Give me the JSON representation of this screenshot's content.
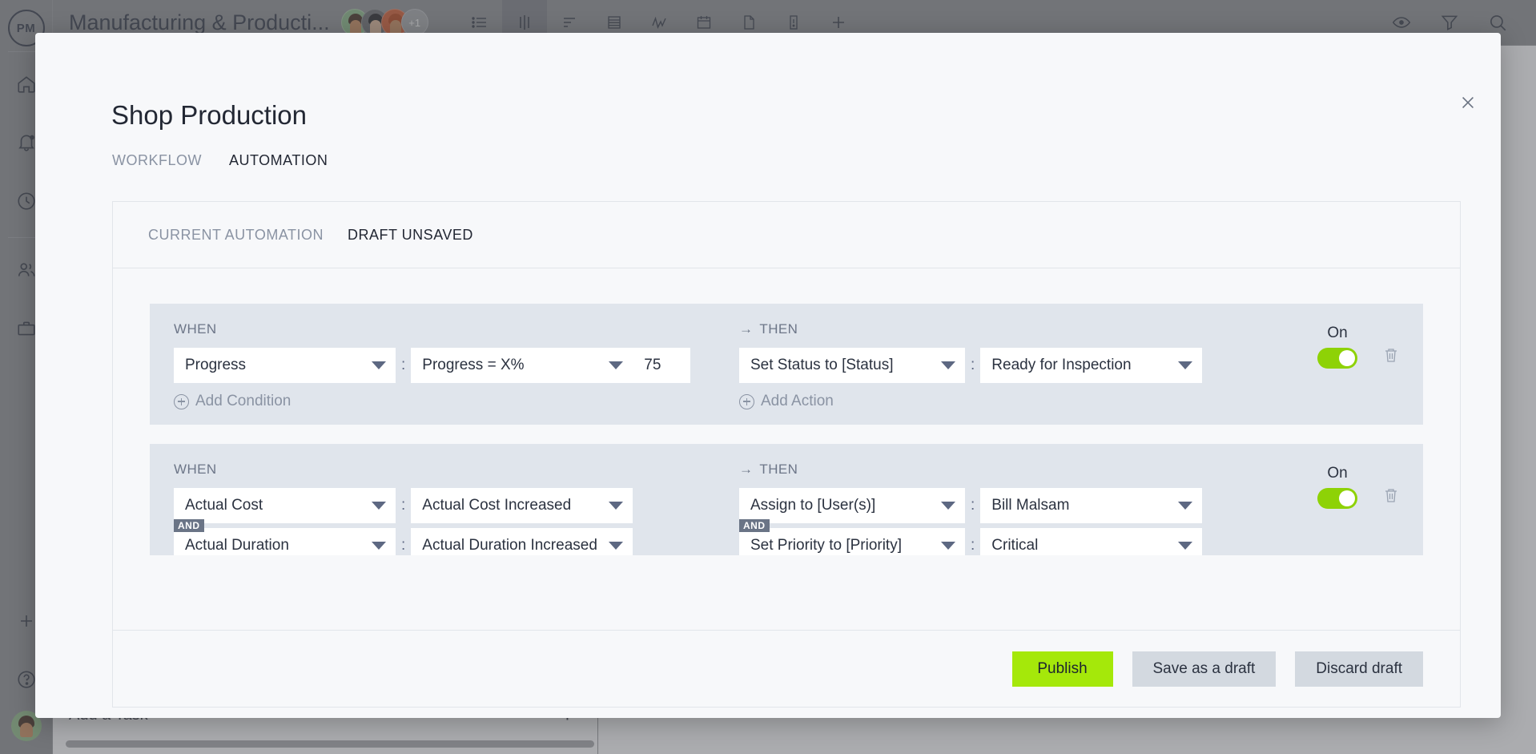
{
  "background": {
    "logo": "PM",
    "project_title": "Manufacturing & Producti...",
    "avatar_more": "+1",
    "sidebar_icons": [
      "home-icon",
      "bell-icon",
      "clock-icon",
      "people-icon",
      "briefcase-icon",
      "plus-icon",
      "help-icon",
      "user-avatar"
    ],
    "toolbar_icons": [
      "list-view-icon",
      "gantt-view-icon",
      "board-view-icon",
      "sheet-view-icon",
      "chart-view-icon",
      "calendar-view-icon",
      "doc-view-icon",
      "risk-view-icon",
      "add-view-icon"
    ],
    "right_icons": [
      "eye-icon",
      "filter-icon",
      "search-icon"
    ],
    "add_task_label": "Add a Task",
    "add_task_plus": "+"
  },
  "modal": {
    "title": "Shop Production",
    "close_icon": "close-icon",
    "tabs": [
      {
        "label": "WORKFLOW",
        "active": false
      },
      {
        "label": "AUTOMATION",
        "active": true
      }
    ],
    "panel_tabs": [
      {
        "label": "CURRENT AUTOMATION",
        "active": false
      },
      {
        "label": "DRAFT UNSAVED",
        "active": true
      }
    ],
    "when_label": "WHEN",
    "then_label": "THEN",
    "then_arrow": "→",
    "colon": ":",
    "and_badge": "AND",
    "add_condition_label": "Add Condition",
    "add_action_label": "Add Action",
    "toggle_on_label": "On",
    "accent_green": "#8ed206",
    "publish_green": "#a5e80a",
    "rules": [
      {
        "conditions": [
          {
            "field": "Progress",
            "operator": "Progress = X%",
            "value": "75"
          }
        ],
        "actions": [
          {
            "action": "Set Status to [Status]",
            "value": "Ready for Inspection"
          }
        ],
        "enabled_label": "On",
        "enabled": true
      },
      {
        "conditions": [
          {
            "field": "Actual Cost",
            "operator": "Actual Cost Increased"
          },
          {
            "field": "Actual Duration",
            "operator": "Actual Duration Increased"
          }
        ],
        "actions": [
          {
            "action": "Assign to [User(s)]",
            "value": "Bill Malsam"
          },
          {
            "action": "Set Priority to [Priority]",
            "value": "Critical"
          }
        ],
        "enabled_label": "On",
        "enabled": true
      }
    ],
    "footer": {
      "publish": "Publish",
      "save_draft": "Save as a draft",
      "discard_draft": "Discard draft"
    }
  }
}
